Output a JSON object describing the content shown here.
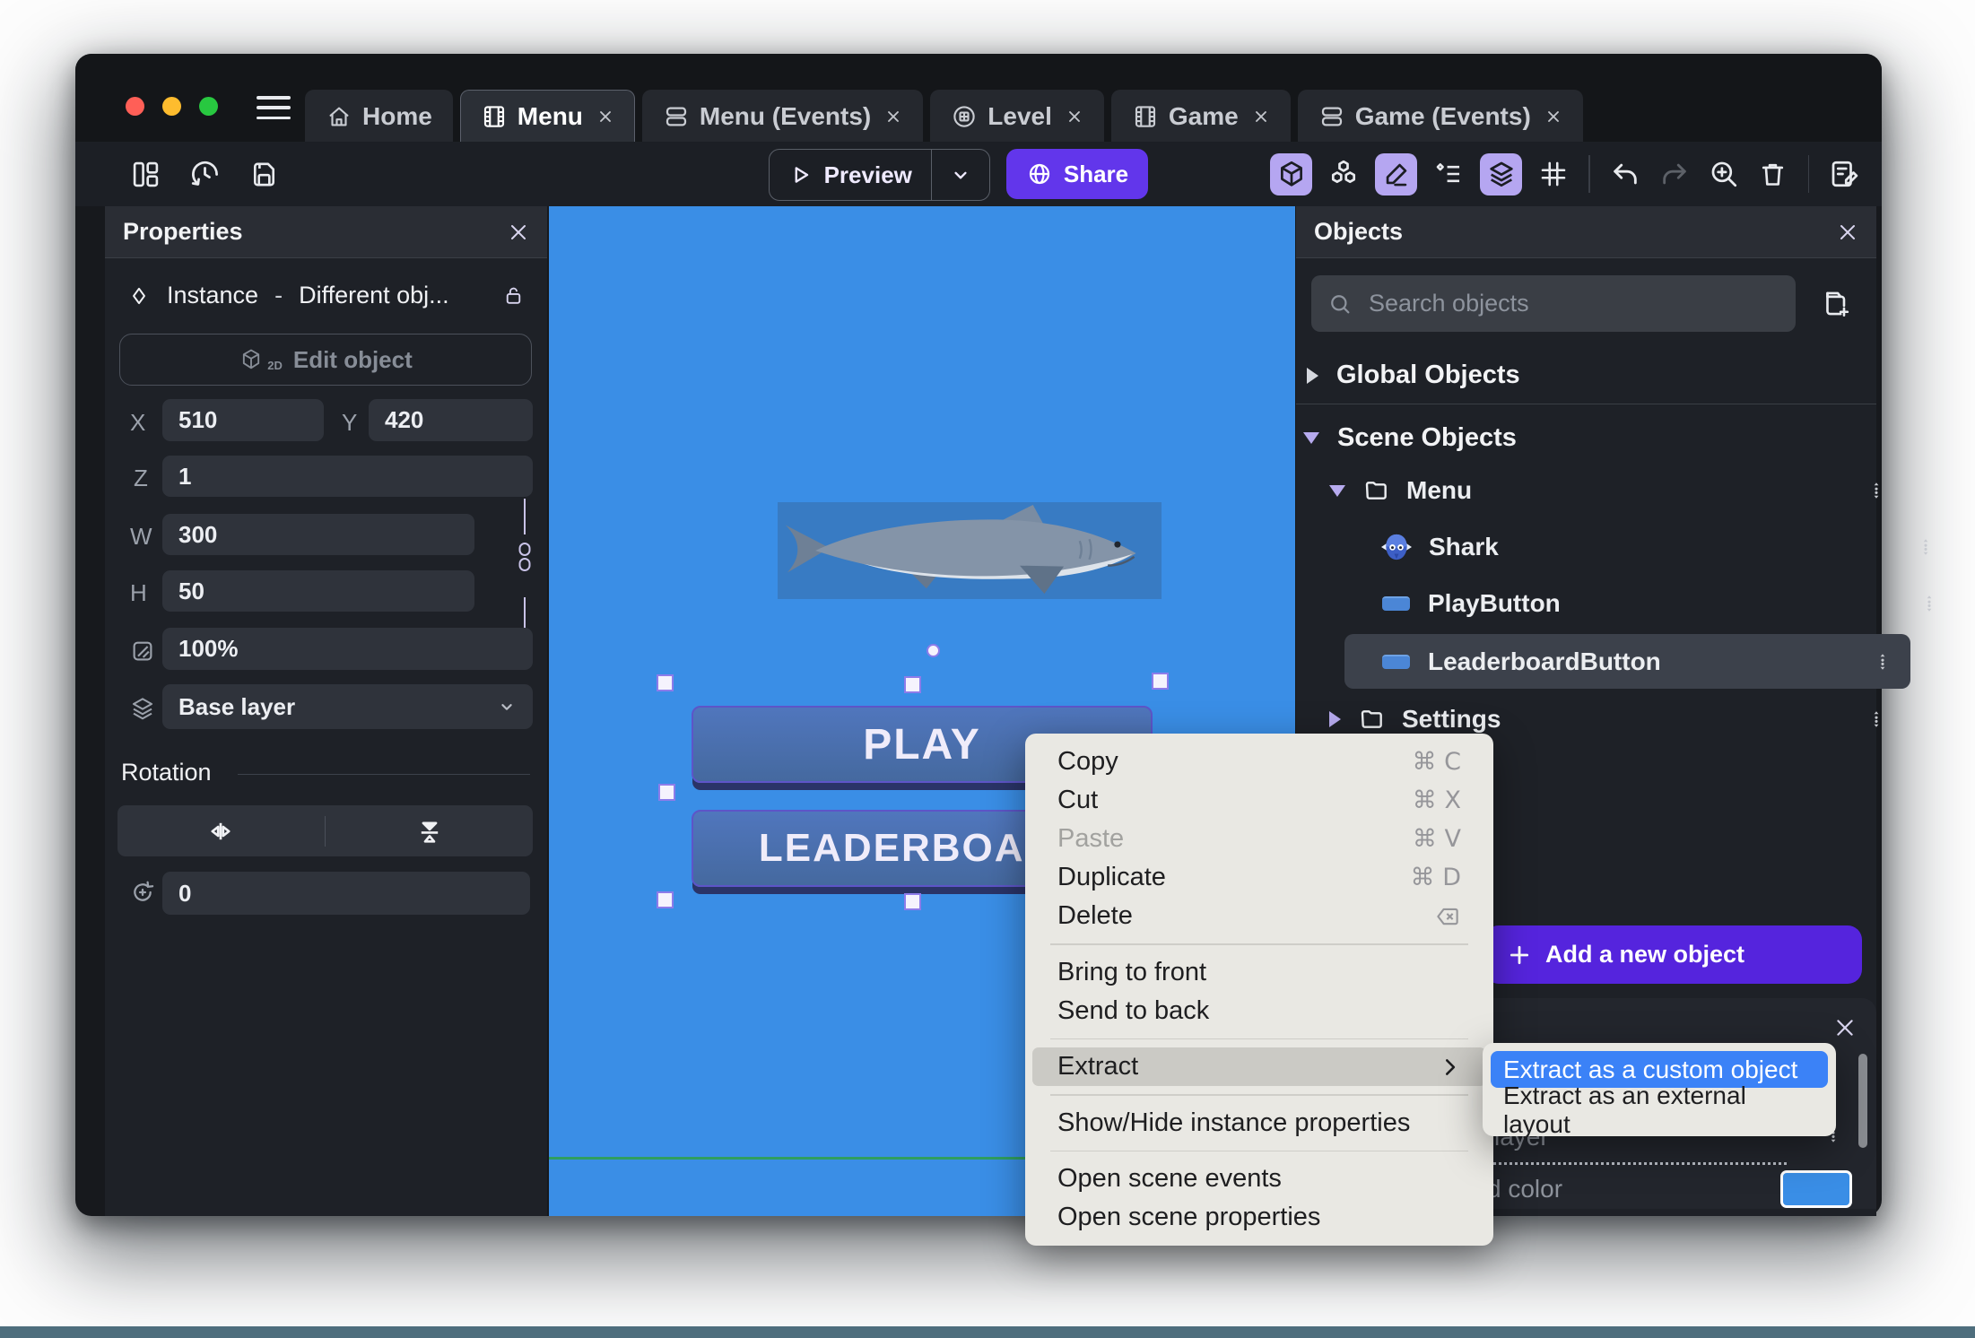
{
  "colors": {
    "canvas_background": "#3A8EE6",
    "accent_purple": "#5524DD",
    "share_purple": "#6236EB",
    "toolbar_active_icon_bg": "#B5A6F1",
    "macos_highlight_blue": "#3B82F7",
    "traffic_close": "#FF5F57",
    "traffic_minimize": "#FEBC2E",
    "traffic_zoom": "#28C840"
  },
  "tabs": [
    {
      "label": "Home"
    },
    {
      "label": "Menu",
      "active": true
    },
    {
      "label": "Menu (Events)"
    },
    {
      "label": "Level"
    },
    {
      "label": "Game"
    },
    {
      "label": "Game (Events)"
    }
  ],
  "toolbar": {
    "preview_label": "Preview",
    "share_label": "Share"
  },
  "properties_panel": {
    "title": "Properties",
    "instance_type": "Instance",
    "separator": "-",
    "instance_object": "Different obj...",
    "edit_object_label": "Edit object",
    "edit_object_badge": "2D",
    "x_label": "X",
    "x_value": "510",
    "y_label": "Y",
    "y_value": "420",
    "z_label": "Z",
    "z_value": "1",
    "w_label": "W",
    "w_value": "300",
    "h_label": "H",
    "h_value": "50",
    "opacity_value": "100%",
    "layer_value": "Base layer",
    "rotation_section_label": "Rotation",
    "rotation_value": "0"
  },
  "canvas": {
    "play_label": "PLAY",
    "leaderboard_label": "LEADERBOARD"
  },
  "objects_panel": {
    "title": "Objects",
    "search_placeholder": "Search objects",
    "global_objects_label": "Global Objects",
    "scene_objects_label": "Scene Objects",
    "tree": [
      {
        "label": "Menu",
        "type": "folder",
        "expanded": true
      },
      {
        "label": "Shark",
        "type": "sprite"
      },
      {
        "label": "PlayButton",
        "type": "button"
      },
      {
        "label": "LeaderboardButton",
        "type": "button",
        "selected": true
      },
      {
        "label": "Settings",
        "type": "folder",
        "expanded": false
      }
    ],
    "add_object_label": "Add a new object",
    "bottom_card": {
      "layer_text": "layer",
      "color_text": "d color",
      "swatch_color": "#3A8EE6"
    }
  },
  "context_menu": {
    "items": [
      {
        "label": "Copy",
        "shortcut": "⌘ C"
      },
      {
        "label": "Cut",
        "shortcut": "⌘ X"
      },
      {
        "label": "Paste",
        "shortcut": "⌘ V",
        "disabled": true
      },
      {
        "label": "Duplicate",
        "shortcut": "⌘ D"
      },
      {
        "label": "Delete",
        "shortcut_icon": "delete-key-icon"
      },
      {
        "label": "Bring to front"
      },
      {
        "label": "Send to back"
      },
      {
        "label": "Extract",
        "highlighted": true,
        "has_submenu": true
      },
      {
        "label": "Show/Hide instance properties"
      },
      {
        "label": "Open scene events"
      },
      {
        "label": "Open scene properties"
      }
    ],
    "submenu": [
      {
        "label": "Extract as a custom object",
        "highlighted": true
      },
      {
        "label": "Extract as an external layout"
      }
    ]
  }
}
